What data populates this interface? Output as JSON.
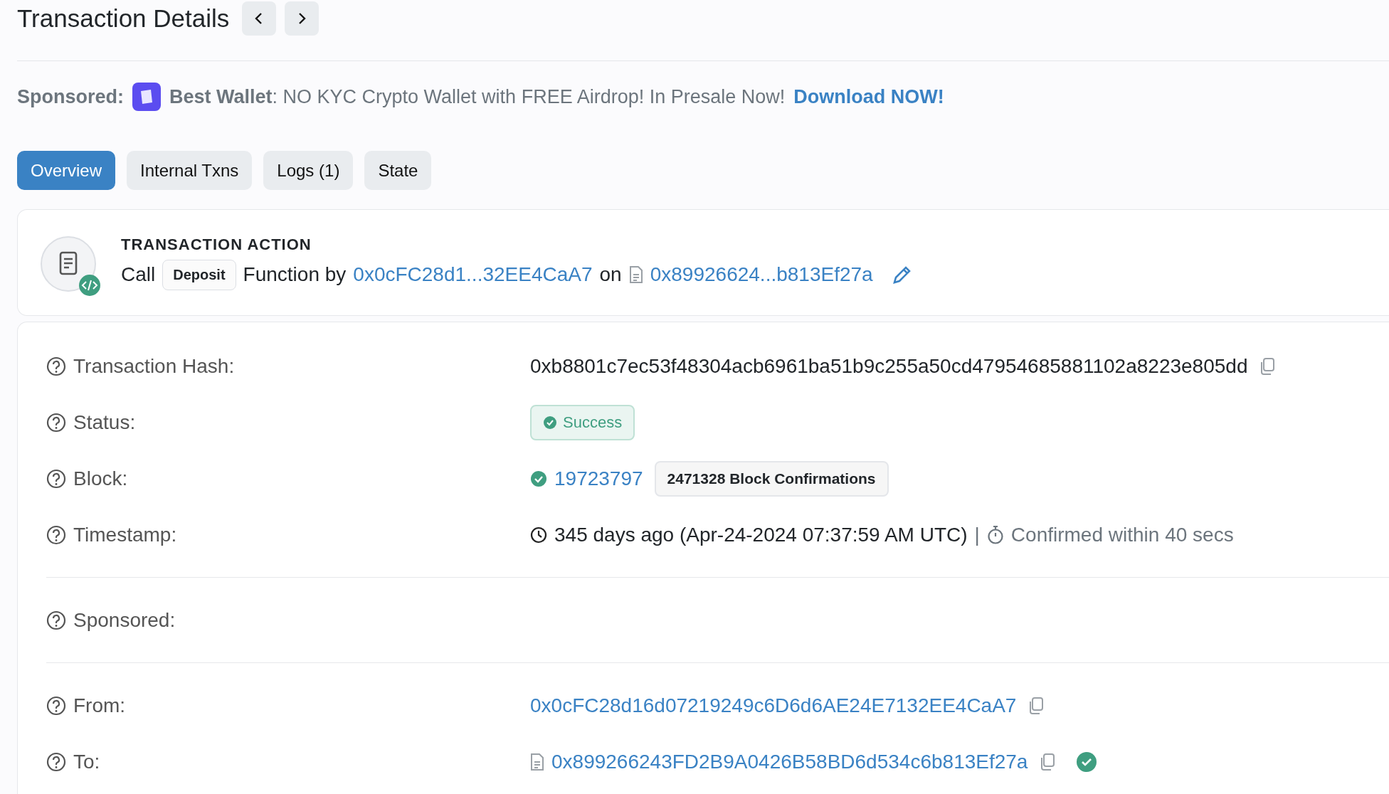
{
  "header": {
    "title": "Transaction Details"
  },
  "sponsored": {
    "label": "Sponsored:",
    "brand": "Best Wallet",
    "text": ": NO KYC Crypto Wallet with FREE Airdrop! In Presale Now! ",
    "link": "Download NOW!"
  },
  "tabs": [
    {
      "label": "Overview",
      "selected": true
    },
    {
      "label": "Internal Txns",
      "selected": false
    },
    {
      "label": "Logs (1)",
      "selected": false
    },
    {
      "label": "State",
      "selected": false
    }
  ],
  "action": {
    "heading": "TRANSACTION ACTION",
    "call": "Call",
    "function": "Deposit",
    "by": "Function by",
    "from": "0x0cFC28d1...32EE4CaA7",
    "on": "on",
    "to": "0x89926624...b813Ef27a"
  },
  "sections": [
    [
      {
        "kind": "text",
        "label": "Transaction Hash:",
        "value": "0xb8801c7ec53f48304acb6961ba51b9c255a50cd47954685881102a8223e805dd",
        "copyable": true
      },
      {
        "kind": "status",
        "label": "Status:",
        "value": "Success"
      },
      {
        "kind": "block",
        "label": "Block:",
        "value": "19723797",
        "confirmations": "2471328 Block Confirmations"
      },
      {
        "kind": "timestamp",
        "label": "Timestamp:",
        "value": "345 days ago (Apr-24-2024 07:37:59 AM UTC)",
        "separator": "|",
        "confirmed": "Confirmed within 40 secs"
      }
    ],
    [
      {
        "kind": "empty",
        "label": "Sponsored:"
      }
    ],
    [
      {
        "kind": "address",
        "label": "From:",
        "value": "0x0cFC28d16d07219249c6D6d6AE24E7132EE4CaA7",
        "copyable": true
      },
      {
        "kind": "address",
        "label": "To:",
        "value": "0x899266243FD2B9A0426B58BD6d534c6b813Ef27a",
        "copyable": true,
        "contract": true,
        "verified": true
      }
    ]
  ]
}
